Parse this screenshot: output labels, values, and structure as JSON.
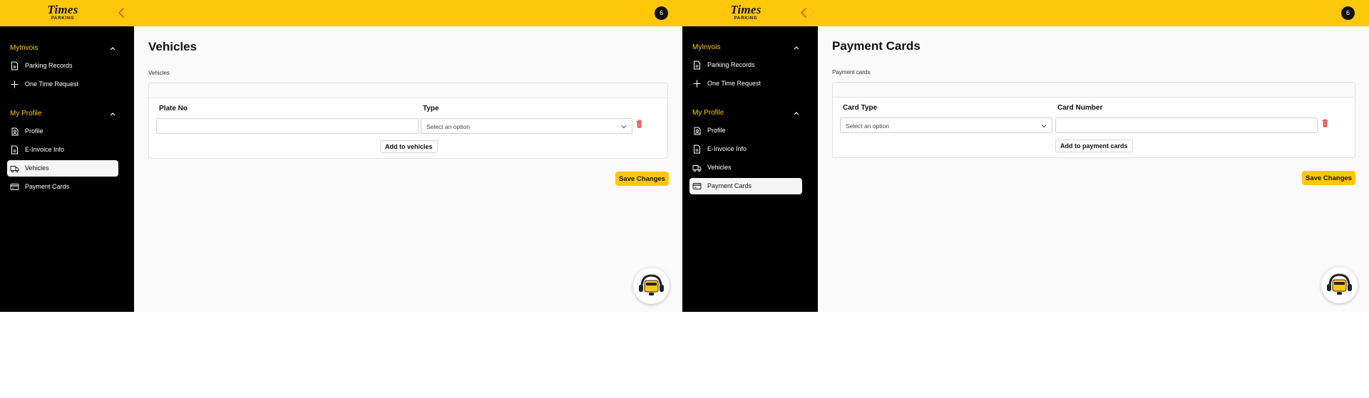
{
  "colors": {
    "brand_yellow": "#ffc709",
    "sidebar_bg": "#000000",
    "danger": "#e53935"
  },
  "logo": {
    "word": "Times",
    "sub": "PARKING"
  },
  "avatar": {
    "label": "6"
  },
  "sidebar": {
    "section1_title": "MyInvois",
    "section2_title": "My Profile",
    "items": {
      "parking_records": "Parking Records",
      "one_time_request": "One Time Request",
      "profile": "Profile",
      "einvoice_info": "E-Invoice Info",
      "vehicles": "Vehicles",
      "payment_cards": "Payment Cards"
    }
  },
  "vehicles_page": {
    "title": "Vehicles",
    "section_label": "Vehicles",
    "col_plate": "Plate No",
    "col_type": "Type",
    "plate_value": "",
    "type_placeholder": "Select an option",
    "add_label": "Add to vehicles",
    "save_label": "Save Changes",
    "active_nav": "vehicles"
  },
  "payment_page": {
    "title": "Payment Cards",
    "section_label": "Payment cards",
    "col_card_type": "Card Type",
    "col_card_number": "Card Number",
    "card_type_placeholder": "Select an option",
    "card_number_value": "",
    "add_label": "Add to payment cards",
    "save_label": "Save Changes",
    "active_nav": "payment-cards"
  },
  "icons": [
    "chevron-left-icon",
    "chevron-up-icon",
    "document-icon",
    "plus-icon",
    "profile-icon",
    "truck-icon",
    "credit-card-icon",
    "trash-icon",
    "chevron-down-icon",
    "support-mascot-icon"
  ]
}
